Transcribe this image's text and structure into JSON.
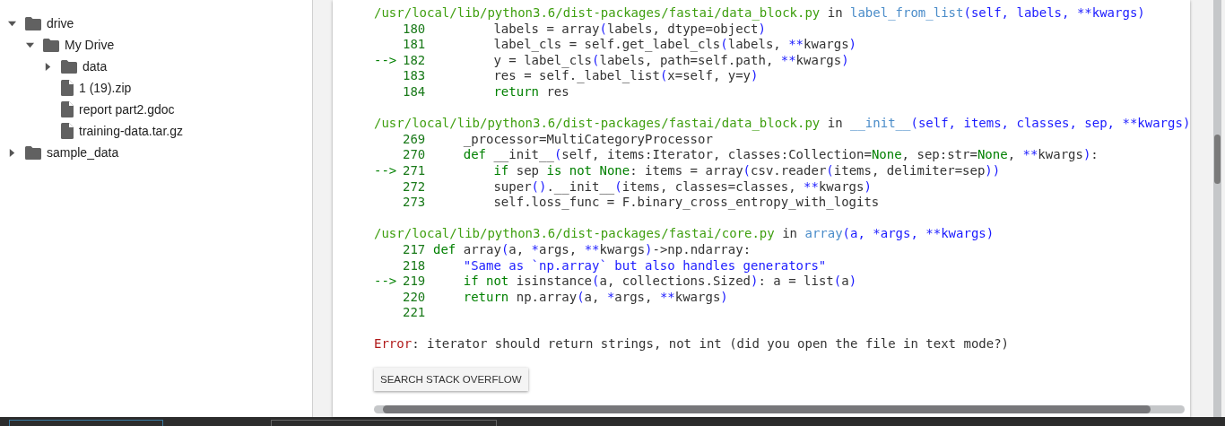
{
  "file_tree": [
    {
      "name": "drive",
      "kind": "folder",
      "expanded": true,
      "children": [
        {
          "name": "My Drive",
          "kind": "folder",
          "expanded": true,
          "children": [
            {
              "name": "data",
              "kind": "folder",
              "expanded": false
            },
            {
              "name": "1 (19).zip",
              "kind": "file"
            },
            {
              "name": "report part2.gdoc",
              "kind": "file"
            },
            {
              "name": "training-data.tar.gz",
              "kind": "file"
            }
          ]
        }
      ]
    },
    {
      "name": "sample_data",
      "kind": "folder",
      "expanded": false
    }
  ],
  "traceback": [
    {
      "header": [
        {
          "kind": "path",
          "text": "/usr/local/lib/python3.6/dist-packages/fastai/data_block.py"
        },
        {
          "kind": "plain",
          "text": " in "
        },
        {
          "kind": "function",
          "text": "label_from_list"
        },
        {
          "kind": "punct",
          "text": "(self, labels, **kwargs)"
        }
      ],
      "lines": [
        {
          "number": "180",
          "code": [
            {
              "kind": "plain",
              "text": "        labels = array"
            },
            {
              "kind": "punct",
              "text": "("
            },
            {
              "kind": "plain",
              "text": "labels, dtype=object"
            },
            {
              "kind": "punct",
              "text": ")"
            }
          ]
        },
        {
          "number": "181",
          "code": [
            {
              "kind": "plain",
              "text": "        label_cls = self.get_label_cls"
            },
            {
              "kind": "punct",
              "text": "("
            },
            {
              "kind": "plain",
              "text": "labels, "
            },
            {
              "kind": "punct",
              "text": "**"
            },
            {
              "kind": "plain",
              "text": "kwargs"
            },
            {
              "kind": "punct",
              "text": ")"
            }
          ]
        },
        {
          "number": "182",
          "marker": "-->",
          "code": [
            {
              "kind": "plain",
              "text": "        y = label_cls"
            },
            {
              "kind": "punct",
              "text": "("
            },
            {
              "kind": "plain",
              "text": "labels, path=self.path, "
            },
            {
              "kind": "punct",
              "text": "**"
            },
            {
              "kind": "plain",
              "text": "kwargs"
            },
            {
              "kind": "punct",
              "text": ")"
            }
          ]
        },
        {
          "number": "183",
          "code": [
            {
              "kind": "plain",
              "text": "        res = self._label_list"
            },
            {
              "kind": "punct",
              "text": "("
            },
            {
              "kind": "plain",
              "text": "x=self, y=y"
            },
            {
              "kind": "punct",
              "text": ")"
            }
          ]
        },
        {
          "number": "184",
          "code": [
            {
              "kind": "keyword",
              "text": "        return"
            },
            {
              "kind": "plain",
              "text": " res"
            }
          ]
        }
      ]
    },
    {
      "header": [
        {
          "kind": "path",
          "text": "/usr/local/lib/python3.6/dist-packages/fastai/data_block.py"
        },
        {
          "kind": "plain",
          "text": " in "
        },
        {
          "kind": "function",
          "text": "__init__"
        },
        {
          "kind": "punct",
          "text": "(self, items, classes, sep, **kwargs)"
        }
      ],
      "lines": [
        {
          "number": "269",
          "code": [
            {
              "kind": "plain",
              "text": "    _processor=MultiCategoryProcessor"
            }
          ]
        },
        {
          "number": "270",
          "code": [
            {
              "kind": "keyword",
              "text": "    def"
            },
            {
              "kind": "plain",
              "text": " __init__"
            },
            {
              "kind": "punct",
              "text": "("
            },
            {
              "kind": "plain",
              "text": "self, items:Iterator, classes:Collection="
            },
            {
              "kind": "keyword",
              "text": "None"
            },
            {
              "kind": "plain",
              "text": ", sep:str="
            },
            {
              "kind": "keyword",
              "text": "None"
            },
            {
              "kind": "plain",
              "text": ", "
            },
            {
              "kind": "punct",
              "text": "**"
            },
            {
              "kind": "plain",
              "text": "kwargs"
            },
            {
              "kind": "punct",
              "text": ")"
            },
            {
              "kind": "plain",
              "text": ":"
            }
          ]
        },
        {
          "number": "271",
          "marker": "-->",
          "code": [
            {
              "kind": "keyword",
              "text": "        if"
            },
            {
              "kind": "plain",
              "text": " sep "
            },
            {
              "kind": "keyword",
              "text": "is not None"
            },
            {
              "kind": "plain",
              "text": ": items = array"
            },
            {
              "kind": "punct",
              "text": "("
            },
            {
              "kind": "plain",
              "text": "csv.reader"
            },
            {
              "kind": "punct",
              "text": "("
            },
            {
              "kind": "plain",
              "text": "items, delimiter=sep"
            },
            {
              "kind": "punct",
              "text": "))"
            }
          ]
        },
        {
          "number": "272",
          "code": [
            {
              "kind": "plain",
              "text": "        super"
            },
            {
              "kind": "punct",
              "text": "()"
            },
            {
              "kind": "plain",
              "text": ".__init__"
            },
            {
              "kind": "punct",
              "text": "("
            },
            {
              "kind": "plain",
              "text": "items, classes=classes, "
            },
            {
              "kind": "punct",
              "text": "**"
            },
            {
              "kind": "plain",
              "text": "kwargs"
            },
            {
              "kind": "punct",
              "text": ")"
            }
          ]
        },
        {
          "number": "273",
          "code": [
            {
              "kind": "plain",
              "text": "        self.loss_func = F.binary_cross_entropy_with_logits"
            }
          ]
        }
      ]
    },
    {
      "header": [
        {
          "kind": "path",
          "text": "/usr/local/lib/python3.6/dist-packages/fastai/core.py"
        },
        {
          "kind": "plain",
          "text": " in "
        },
        {
          "kind": "function",
          "text": "array"
        },
        {
          "kind": "punct",
          "text": "(a, *args, **kwargs)"
        }
      ],
      "lines": [
        {
          "number": "217",
          "code": [
            {
              "kind": "keyword",
              "text": "def"
            },
            {
              "kind": "plain",
              "text": " array"
            },
            {
              "kind": "punct",
              "text": "("
            },
            {
              "kind": "plain",
              "text": "a, "
            },
            {
              "kind": "punct",
              "text": "*"
            },
            {
              "kind": "plain",
              "text": "args, "
            },
            {
              "kind": "punct",
              "text": "**"
            },
            {
              "kind": "plain",
              "text": "kwargs"
            },
            {
              "kind": "punct",
              "text": ")"
            },
            {
              "kind": "plain",
              "text": "->np.ndarray:"
            }
          ]
        },
        {
          "number": "218",
          "code": [
            {
              "kind": "punct",
              "text": "    \"Same as `np.array` but also handles generators\""
            }
          ]
        },
        {
          "number": "219",
          "marker": "-->",
          "code": [
            {
              "kind": "keyword",
              "text": "    if not"
            },
            {
              "kind": "plain",
              "text": " isinstance"
            },
            {
              "kind": "punct",
              "text": "("
            },
            {
              "kind": "plain",
              "text": "a, collections.Sized"
            },
            {
              "kind": "punct",
              "text": ")"
            },
            {
              "kind": "plain",
              "text": ": a = list"
            },
            {
              "kind": "punct",
              "text": "("
            },
            {
              "kind": "plain",
              "text": "a"
            },
            {
              "kind": "punct",
              "text": ")"
            }
          ]
        },
        {
          "number": "220",
          "code": [
            {
              "kind": "keyword",
              "text": "    return"
            },
            {
              "kind": "plain",
              "text": " np.array"
            },
            {
              "kind": "punct",
              "text": "("
            },
            {
              "kind": "plain",
              "text": "a, "
            },
            {
              "kind": "punct",
              "text": "*"
            },
            {
              "kind": "plain",
              "text": "args, "
            },
            {
              "kind": "punct",
              "text": "**"
            },
            {
              "kind": "plain",
              "text": "kwargs"
            },
            {
              "kind": "punct",
              "text": ")"
            }
          ]
        },
        {
          "number": "221"
        }
      ]
    }
  ],
  "error": {
    "label": "Error",
    "message": ": iterator should return strings, not int (did you open the file in text mode?)"
  },
  "search_button": "SEARCH STACK OVERFLOW"
}
